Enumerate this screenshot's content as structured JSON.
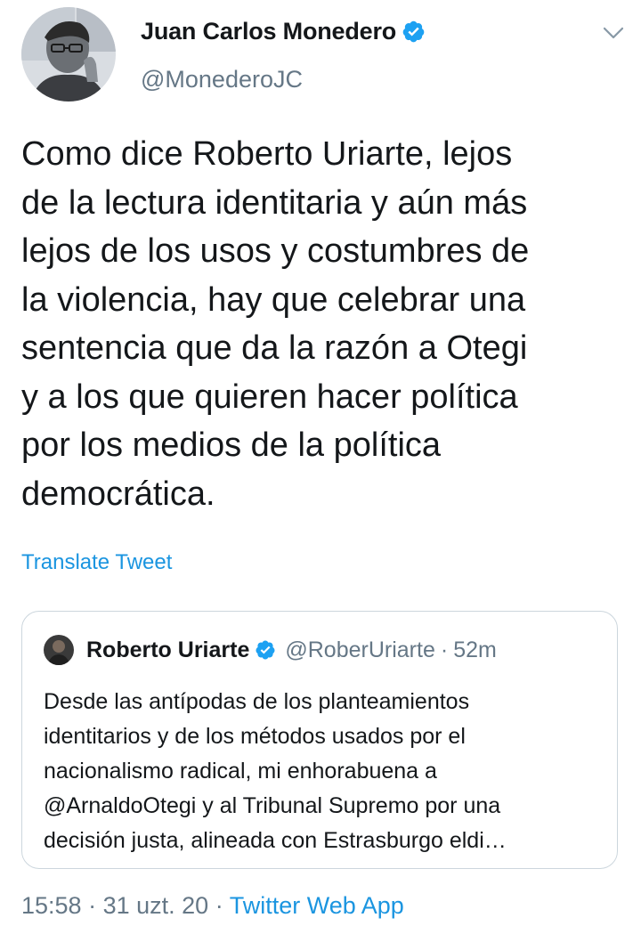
{
  "author": {
    "display_name": "Juan Carlos Monedero",
    "handle": "@MonederoJC",
    "verified_icon": "verified-badge-icon"
  },
  "tweet": {
    "text": "Como dice Roberto Uriarte, lejos\nde la lectura identitaria y aún más\nlejos de los usos y costumbres de\nla violencia, hay que celebrar una\nsentencia que da la razón a Otegi\ny a los que quieren hacer política\npor los medios de la política\ndemocrática.",
    "translate_label": "Translate Tweet",
    "time": "15:58",
    "separator": "·",
    "date": "31 uzt. 20",
    "source": "Twitter Web App"
  },
  "quoted_tweet": {
    "display_name": "Roberto Uriarte",
    "handle": "@RoberUriarte",
    "separator": "·",
    "time": "52m",
    "text": "Desde las antípodas de los planteamientos\nidentitarios y de los métodos usados por el\nnacionalismo radical, mi enhorabuena a\n@ArnaldoOtegi y al Tribunal Supremo por una\ndecisión justa, alineada con Estrasburgo eldi…"
  },
  "colors": {
    "accent": "#1b95e0",
    "verified": "#1da1f2",
    "secondary_text": "#657786",
    "border": "#ccd6dd"
  }
}
